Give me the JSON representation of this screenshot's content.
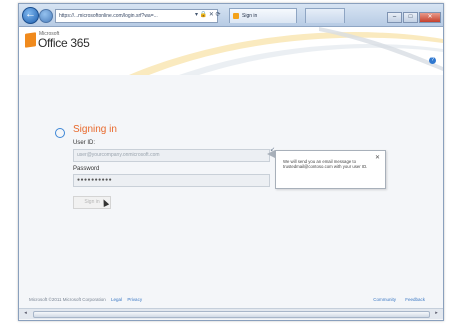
{
  "browser": {
    "address": "https://...microsoftonline.com/login.srf?wa=...",
    "address_icons": "▾ 🔒 ✕ ⟳",
    "tabs": [
      {
        "label": "Sign in"
      },
      {
        "label": ""
      }
    ],
    "controls": {
      "minimize": "–",
      "maximize": "□",
      "close": "✕"
    }
  },
  "banner": {
    "logo_brand": "Microsoft",
    "logo_text": "Office 365",
    "help_icon": "?"
  },
  "signin": {
    "title": "Signing in",
    "user_id_label": "User ID:",
    "user_id_value": "user@yourcompany.onmicrosoft.com",
    "password_label": "Password",
    "password_value": "●●●●●●●●●●",
    "button_label": "Sign in"
  },
  "tooltip": {
    "text": "We will send you an email message to trustedmail@contoso.com with your user ID.",
    "close": "✕"
  },
  "footer": {
    "copyright": "Microsoft  ©2011 Microsoft Corporation",
    "legal": "Legal",
    "privacy": "Privacy",
    "community": "Community",
    "feedback": "Feedback"
  },
  "colors": {
    "accent": "#e8692c",
    "link": "#3b78c4",
    "logo_orange": "#f08a1d"
  }
}
